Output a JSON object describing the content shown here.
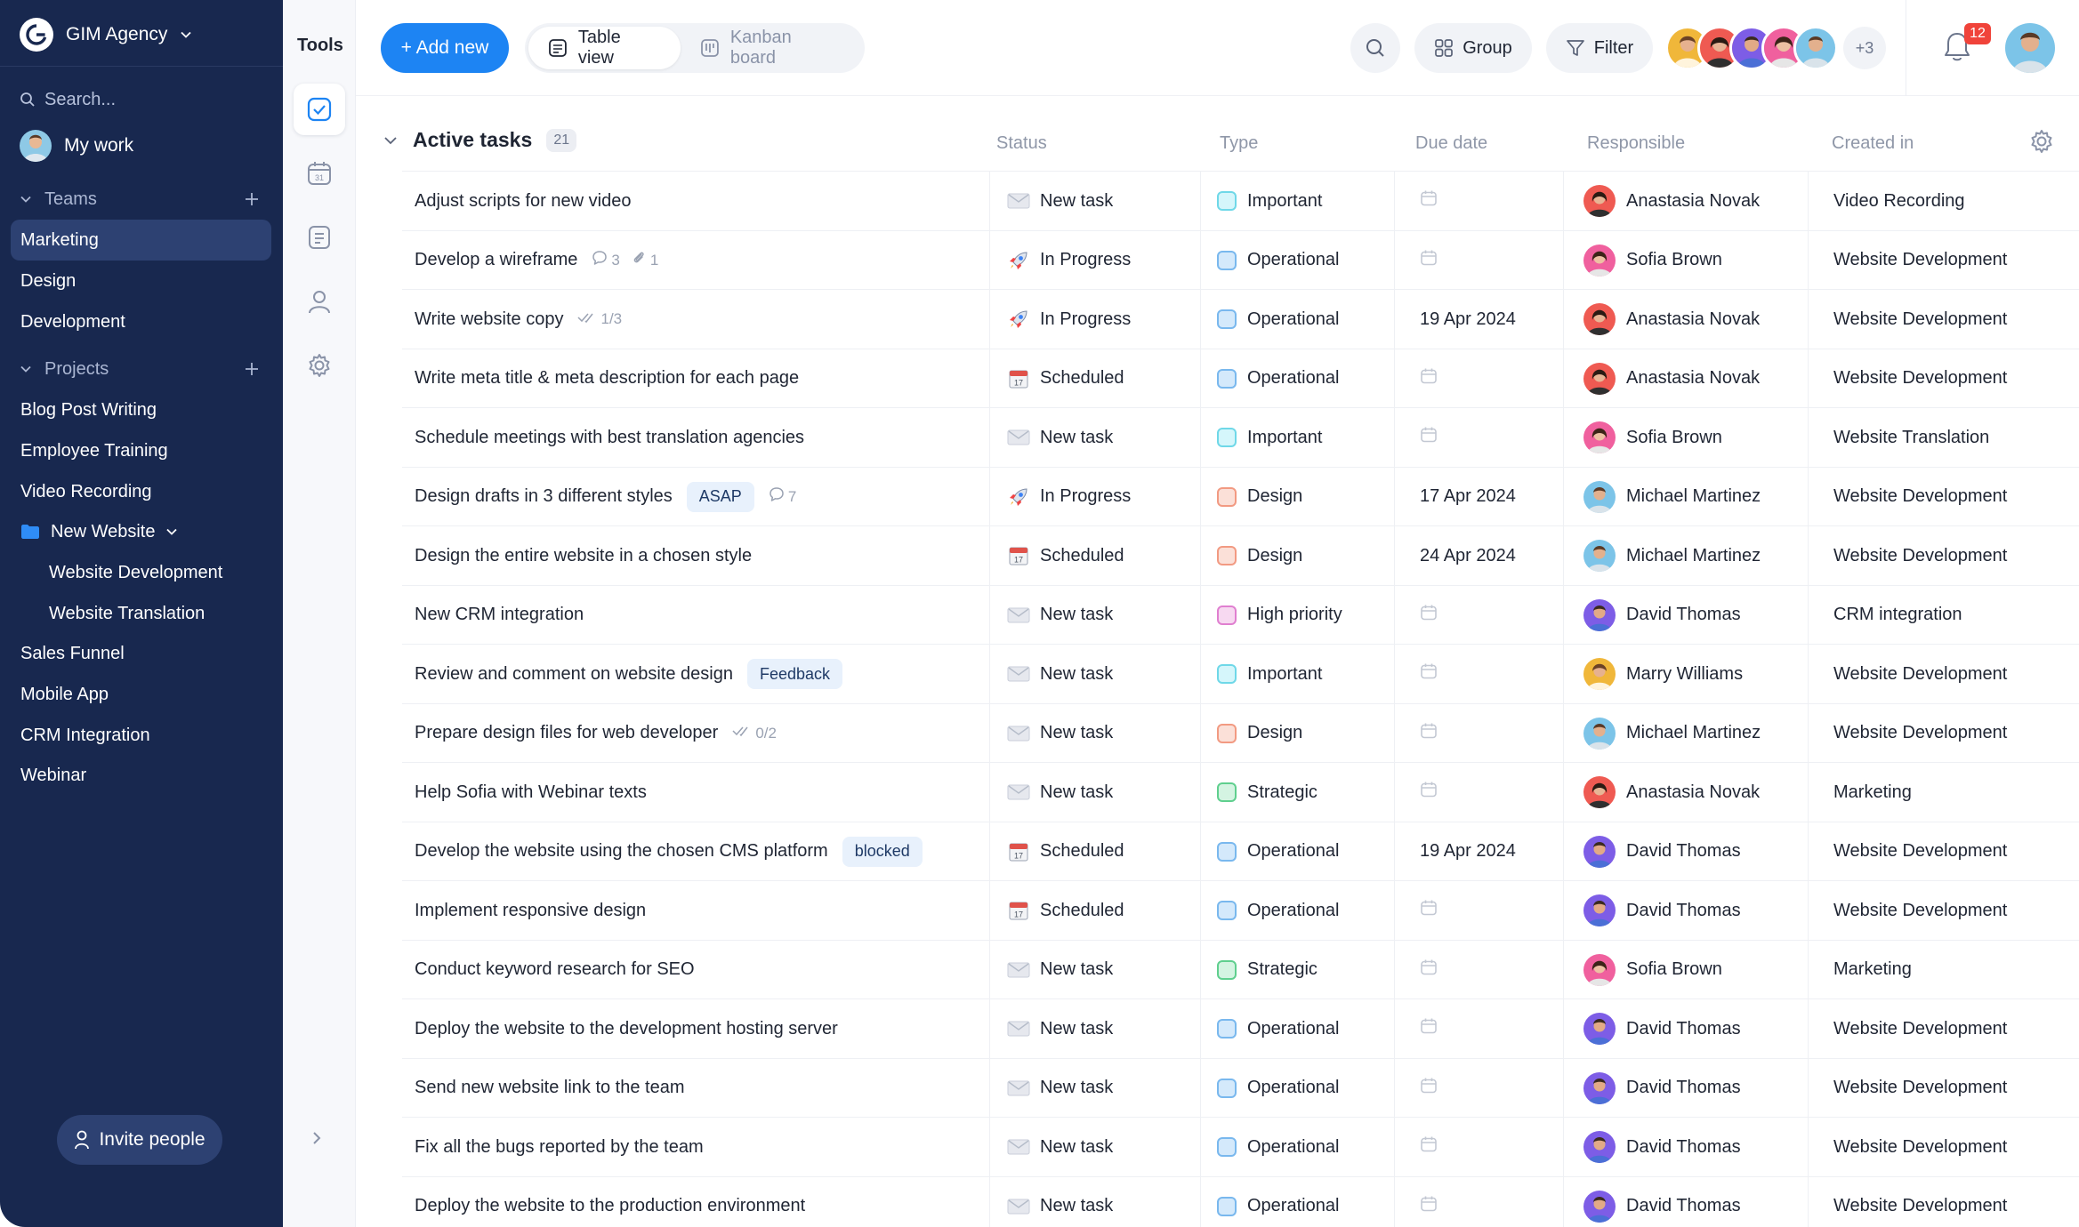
{
  "sidebar": {
    "org_name": "GIM Agency",
    "search_placeholder": "Search...",
    "my_work": "My work",
    "teams_label": "Teams",
    "teams": [
      "Marketing",
      "Design",
      "Development"
    ],
    "active_team": "Marketing",
    "projects_label": "Projects",
    "projects": [
      "Blog Post Writing",
      "Employee Training",
      "Video Recording"
    ],
    "folder": {
      "label": "New Website",
      "children": [
        "Website Development",
        "Website Translation"
      ]
    },
    "projects_after": [
      "Sales Funnel",
      "Mobile App",
      "CRM Integration",
      "Webinar"
    ],
    "invite_label": "Invite people"
  },
  "tools": {
    "title": "Tools"
  },
  "toolbar": {
    "add_label": "+ Add new",
    "views": [
      "Table view",
      "Kanban board"
    ],
    "active_view": "Table view",
    "group_label": "Group",
    "filter_label": "Filter",
    "more_members": "+3",
    "notifications": "12"
  },
  "colors": {
    "accent": "#1d84f3",
    "sidebar_bg": "#18284f",
    "sidebar_active": "#2d4172",
    "badge": "#f0433a"
  },
  "table": {
    "group_title": "Active tasks",
    "group_count": "21",
    "columns": [
      "Status",
      "Type",
      "Due date",
      "Responsible",
      "Created in"
    ],
    "rows": [
      {
        "name": "Adjust scripts for new video",
        "status": "New task",
        "status_icon": "envelope-icon",
        "type": "Important",
        "type_color": "important",
        "due": "",
        "resp": "Anastasia Novak",
        "resp_av": "anastasia",
        "created": "Video Recording"
      },
      {
        "name": "Develop a wireframe",
        "comments": "3",
        "attachments": "1",
        "status": "In Progress",
        "status_icon": "rocket-icon",
        "type": "Operational",
        "type_color": "operational",
        "due": "",
        "resp": "Sofia Brown",
        "resp_av": "sofia",
        "created": "Website Development"
      },
      {
        "name": "Write website copy",
        "checklist": "1/3",
        "status": "In Progress",
        "status_icon": "rocket-icon",
        "type": "Operational",
        "type_color": "operational",
        "due": "19 Apr 2024",
        "resp": "Anastasia Novak",
        "resp_av": "anastasia",
        "created": "Website Development"
      },
      {
        "name": "Write meta title & meta description for each page",
        "status": "Scheduled",
        "status_icon": "calendar-emoji-icon",
        "type": "Operational",
        "type_color": "operational",
        "due": "",
        "resp": "Anastasia Novak",
        "resp_av": "anastasia",
        "created": "Website Development"
      },
      {
        "name": "Schedule meetings with best translation agencies",
        "status": "New task",
        "status_icon": "envelope-icon",
        "type": "Important",
        "type_color": "important",
        "due": "",
        "resp": "Sofia Brown",
        "resp_av": "sofia",
        "created": "Website Translation"
      },
      {
        "name": "Design drafts in 3 different styles",
        "tag": "ASAP",
        "comments": "7",
        "status": "In Progress",
        "status_icon": "rocket-icon",
        "type": "Design",
        "type_color": "design",
        "due": "17 Apr 2024",
        "resp": "Michael Martinez",
        "resp_av": "michael",
        "created": "Website Development"
      },
      {
        "name": "Design the entire website in a chosen style",
        "status": "Scheduled",
        "status_icon": "calendar-emoji-icon",
        "type": "Design",
        "type_color": "design",
        "due": "24 Apr 2024",
        "resp": "Michael Martinez",
        "resp_av": "michael",
        "created": "Website Development"
      },
      {
        "name": "New CRM integration",
        "status": "New task",
        "status_icon": "envelope-icon",
        "type": "High priority",
        "type_color": "high",
        "due": "",
        "resp": "David Thomas",
        "resp_av": "david",
        "created": "CRM integration"
      },
      {
        "name": "Review and comment on website design",
        "tag": "Feedback",
        "status": "New task",
        "status_icon": "envelope-icon",
        "type": "Important",
        "type_color": "important",
        "due": "",
        "resp": "Marry Williams",
        "resp_av": "marry",
        "created": "Website Development"
      },
      {
        "name": "Prepare design files for web developer",
        "checklist": "0/2",
        "status": "New task",
        "status_icon": "envelope-icon",
        "type": "Design",
        "type_color": "design",
        "due": "",
        "resp": "Michael Martinez",
        "resp_av": "michael",
        "created": "Website Development"
      },
      {
        "name": "Help Sofia with Webinar texts",
        "status": "New task",
        "status_icon": "envelope-icon",
        "type": "Strategic",
        "type_color": "strategic",
        "due": "",
        "resp": "Anastasia Novak",
        "resp_av": "anastasia",
        "created": "Marketing"
      },
      {
        "name": "Develop the website using the chosen CMS platform",
        "tag": "blocked",
        "status": "Scheduled",
        "status_icon": "calendar-emoji-icon",
        "type": "Operational",
        "type_color": "operational",
        "due": "19 Apr 2024",
        "resp": "David Thomas",
        "resp_av": "david",
        "created": "Website Development"
      },
      {
        "name": "Implement responsive design",
        "status": "Scheduled",
        "status_icon": "calendar-emoji-icon",
        "type": "Operational",
        "type_color": "operational",
        "due": "",
        "resp": "David Thomas",
        "resp_av": "david",
        "created": "Website Development"
      },
      {
        "name": "Conduct keyword research for SEO",
        "status": "New task",
        "status_icon": "envelope-icon",
        "type": "Strategic",
        "type_color": "strategic",
        "due": "",
        "resp": "Sofia Brown",
        "resp_av": "sofia",
        "created": "Marketing"
      },
      {
        "name": "Deploy the website to the development hosting server",
        "status": "New task",
        "status_icon": "envelope-icon",
        "type": "Operational",
        "type_color": "operational",
        "due": "",
        "resp": "David Thomas",
        "resp_av": "david",
        "created": "Website Development"
      },
      {
        "name": "Send new website link to the team",
        "status": "New task",
        "status_icon": "envelope-icon",
        "type": "Operational",
        "type_color": "operational",
        "due": "",
        "resp": "David Thomas",
        "resp_av": "david",
        "created": "Website Development"
      },
      {
        "name": "Fix all the bugs reported by the team",
        "status": "New task",
        "status_icon": "envelope-icon",
        "type": "Operational",
        "type_color": "operational",
        "due": "",
        "resp": "David Thomas",
        "resp_av": "david",
        "created": "Website Development"
      },
      {
        "name": "Deploy the website to the production environment",
        "status": "New task",
        "status_icon": "envelope-icon",
        "type": "Operational",
        "type_color": "operational",
        "due": "",
        "resp": "David Thomas",
        "resp_av": "david",
        "created": "Website Development"
      }
    ]
  }
}
